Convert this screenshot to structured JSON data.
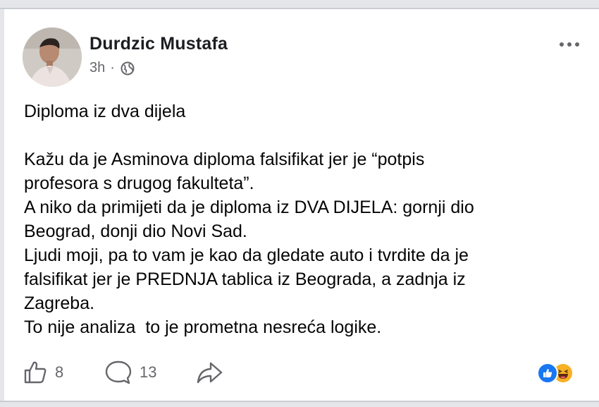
{
  "post": {
    "author": "Durdzic Mustafa",
    "time": "3h",
    "separator": "·",
    "audience_icon": "globe-icon",
    "more_icon": "more-horizontal-icon",
    "title": "Diploma iz dva dijela",
    "paragraphs": [
      "Kažu da je Asminova diploma falsifikat jer je “potpis\nprofesora s drugog fakulteta”.",
      "A niko da primijeti da je diploma iz DVA DIJELA: gornji dio\nBeograd, donji dio Novi Sad.",
      "Ljudi moji, pa to vam je kao da gledate auto i tvrdite da je\nfalsifikat jer je PREDNJA tablica iz Beograda, a zadnja iz\nZagreba.",
      "To nije analiza  to je prometna nesreća logike."
    ]
  },
  "footer": {
    "likes": "8",
    "comments": "13",
    "like_icon": "thumbs-up-icon",
    "comment_icon": "comment-icon",
    "share_icon": "share-icon",
    "reactions": [
      "like-reaction-icon",
      "haha-reaction-icon"
    ],
    "colors": {
      "like": "#1877f2",
      "haha": "#f7b125",
      "muted": "#65676b"
    }
  }
}
